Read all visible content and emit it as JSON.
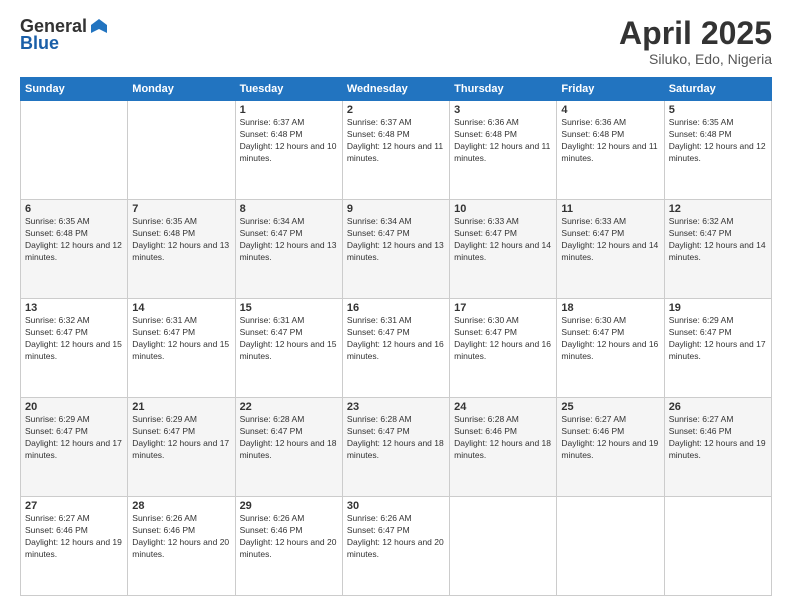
{
  "logo": {
    "general": "General",
    "blue": "Blue"
  },
  "title": "April 2025",
  "location": "Siluko, Edo, Nigeria",
  "weekdays": [
    "Sunday",
    "Monday",
    "Tuesday",
    "Wednesday",
    "Thursday",
    "Friday",
    "Saturday"
  ],
  "weeks": [
    [
      {
        "day": "",
        "sunrise": "",
        "sunset": "",
        "daylight": ""
      },
      {
        "day": "",
        "sunrise": "",
        "sunset": "",
        "daylight": ""
      },
      {
        "day": "1",
        "sunrise": "Sunrise: 6:37 AM",
        "sunset": "Sunset: 6:48 PM",
        "daylight": "Daylight: 12 hours and 10 minutes."
      },
      {
        "day": "2",
        "sunrise": "Sunrise: 6:37 AM",
        "sunset": "Sunset: 6:48 PM",
        "daylight": "Daylight: 12 hours and 11 minutes."
      },
      {
        "day": "3",
        "sunrise": "Sunrise: 6:36 AM",
        "sunset": "Sunset: 6:48 PM",
        "daylight": "Daylight: 12 hours and 11 minutes."
      },
      {
        "day": "4",
        "sunrise": "Sunrise: 6:36 AM",
        "sunset": "Sunset: 6:48 PM",
        "daylight": "Daylight: 12 hours and 11 minutes."
      },
      {
        "day": "5",
        "sunrise": "Sunrise: 6:35 AM",
        "sunset": "Sunset: 6:48 PM",
        "daylight": "Daylight: 12 hours and 12 minutes."
      }
    ],
    [
      {
        "day": "6",
        "sunrise": "Sunrise: 6:35 AM",
        "sunset": "Sunset: 6:48 PM",
        "daylight": "Daylight: 12 hours and 12 minutes."
      },
      {
        "day": "7",
        "sunrise": "Sunrise: 6:35 AM",
        "sunset": "Sunset: 6:48 PM",
        "daylight": "Daylight: 12 hours and 13 minutes."
      },
      {
        "day": "8",
        "sunrise": "Sunrise: 6:34 AM",
        "sunset": "Sunset: 6:47 PM",
        "daylight": "Daylight: 12 hours and 13 minutes."
      },
      {
        "day": "9",
        "sunrise": "Sunrise: 6:34 AM",
        "sunset": "Sunset: 6:47 PM",
        "daylight": "Daylight: 12 hours and 13 minutes."
      },
      {
        "day": "10",
        "sunrise": "Sunrise: 6:33 AM",
        "sunset": "Sunset: 6:47 PM",
        "daylight": "Daylight: 12 hours and 14 minutes."
      },
      {
        "day": "11",
        "sunrise": "Sunrise: 6:33 AM",
        "sunset": "Sunset: 6:47 PM",
        "daylight": "Daylight: 12 hours and 14 minutes."
      },
      {
        "day": "12",
        "sunrise": "Sunrise: 6:32 AM",
        "sunset": "Sunset: 6:47 PM",
        "daylight": "Daylight: 12 hours and 14 minutes."
      }
    ],
    [
      {
        "day": "13",
        "sunrise": "Sunrise: 6:32 AM",
        "sunset": "Sunset: 6:47 PM",
        "daylight": "Daylight: 12 hours and 15 minutes."
      },
      {
        "day": "14",
        "sunrise": "Sunrise: 6:31 AM",
        "sunset": "Sunset: 6:47 PM",
        "daylight": "Daylight: 12 hours and 15 minutes."
      },
      {
        "day": "15",
        "sunrise": "Sunrise: 6:31 AM",
        "sunset": "Sunset: 6:47 PM",
        "daylight": "Daylight: 12 hours and 15 minutes."
      },
      {
        "day": "16",
        "sunrise": "Sunrise: 6:31 AM",
        "sunset": "Sunset: 6:47 PM",
        "daylight": "Daylight: 12 hours and 16 minutes."
      },
      {
        "day": "17",
        "sunrise": "Sunrise: 6:30 AM",
        "sunset": "Sunset: 6:47 PM",
        "daylight": "Daylight: 12 hours and 16 minutes."
      },
      {
        "day": "18",
        "sunrise": "Sunrise: 6:30 AM",
        "sunset": "Sunset: 6:47 PM",
        "daylight": "Daylight: 12 hours and 16 minutes."
      },
      {
        "day": "19",
        "sunrise": "Sunrise: 6:29 AM",
        "sunset": "Sunset: 6:47 PM",
        "daylight": "Daylight: 12 hours and 17 minutes."
      }
    ],
    [
      {
        "day": "20",
        "sunrise": "Sunrise: 6:29 AM",
        "sunset": "Sunset: 6:47 PM",
        "daylight": "Daylight: 12 hours and 17 minutes."
      },
      {
        "day": "21",
        "sunrise": "Sunrise: 6:29 AM",
        "sunset": "Sunset: 6:47 PM",
        "daylight": "Daylight: 12 hours and 17 minutes."
      },
      {
        "day": "22",
        "sunrise": "Sunrise: 6:28 AM",
        "sunset": "Sunset: 6:47 PM",
        "daylight": "Daylight: 12 hours and 18 minutes."
      },
      {
        "day": "23",
        "sunrise": "Sunrise: 6:28 AM",
        "sunset": "Sunset: 6:47 PM",
        "daylight": "Daylight: 12 hours and 18 minutes."
      },
      {
        "day": "24",
        "sunrise": "Sunrise: 6:28 AM",
        "sunset": "Sunset: 6:46 PM",
        "daylight": "Daylight: 12 hours and 18 minutes."
      },
      {
        "day": "25",
        "sunrise": "Sunrise: 6:27 AM",
        "sunset": "Sunset: 6:46 PM",
        "daylight": "Daylight: 12 hours and 19 minutes."
      },
      {
        "day": "26",
        "sunrise": "Sunrise: 6:27 AM",
        "sunset": "Sunset: 6:46 PM",
        "daylight": "Daylight: 12 hours and 19 minutes."
      }
    ],
    [
      {
        "day": "27",
        "sunrise": "Sunrise: 6:27 AM",
        "sunset": "Sunset: 6:46 PM",
        "daylight": "Daylight: 12 hours and 19 minutes."
      },
      {
        "day": "28",
        "sunrise": "Sunrise: 6:26 AM",
        "sunset": "Sunset: 6:46 PM",
        "daylight": "Daylight: 12 hours and 20 minutes."
      },
      {
        "day": "29",
        "sunrise": "Sunrise: 6:26 AM",
        "sunset": "Sunset: 6:46 PM",
        "daylight": "Daylight: 12 hours and 20 minutes."
      },
      {
        "day": "30",
        "sunrise": "Sunrise: 6:26 AM",
        "sunset": "Sunset: 6:47 PM",
        "daylight": "Daylight: 12 hours and 20 minutes."
      },
      {
        "day": "",
        "sunrise": "",
        "sunset": "",
        "daylight": ""
      },
      {
        "day": "",
        "sunrise": "",
        "sunset": "",
        "daylight": ""
      },
      {
        "day": "",
        "sunrise": "",
        "sunset": "",
        "daylight": ""
      }
    ]
  ]
}
